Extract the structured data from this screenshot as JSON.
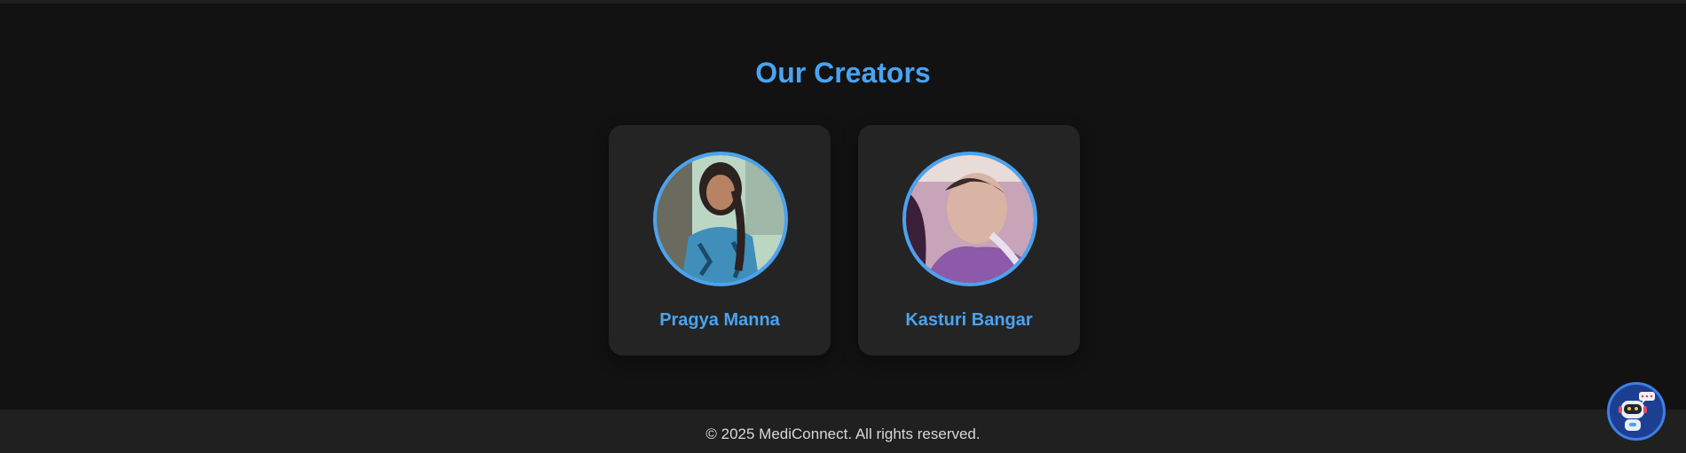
{
  "section": {
    "title": "Our Creators"
  },
  "creators": [
    {
      "name": "Pragya Manna"
    },
    {
      "name": "Kasturi Bangar"
    }
  ],
  "footer": {
    "text": "© 2025 MediConnect. All rights reserved."
  },
  "colors": {
    "accent": "#4aa3f0",
    "background": "#121212",
    "card": "#242424",
    "footer": "#202020"
  },
  "icons": {
    "chatbot": "robot-chatbot-icon"
  }
}
